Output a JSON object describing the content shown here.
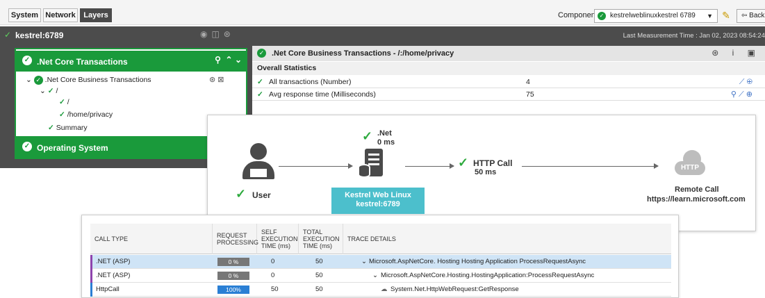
{
  "tabs": [
    "System",
    "Network",
    "Layers"
  ],
  "component": {
    "label": "Component",
    "selected": "kestrelweblinuxkestrel 6789"
  },
  "back_label": "Back",
  "host": {
    "name": "kestrel:6789",
    "last_measurement": "Last Measurement Time : Jan 02, 2023 08:54:24"
  },
  "tree": {
    "header": ".Net Core Transactions",
    "items": [
      ".Net Core Business Transactions",
      "/",
      "/",
      "/home/privacy",
      "Summary"
    ],
    "footer": "Operating System"
  },
  "details": {
    "title": ".Net Core Business Transactions - /:/home/privacy",
    "section": "Overall Statistics",
    "rows": [
      {
        "label": "All transactions (Number)",
        "value": "4"
      },
      {
        "label": "Avg response time (Milliseconds)",
        "value": "75"
      }
    ]
  },
  "topology": {
    "dotnet_label": ".Net",
    "dotnet_time": "0 ms",
    "user_label": "User",
    "http_label": "HTTP Call",
    "http_time": "50 ms",
    "server_name": "Kestrel Web Linux",
    "server_host": "kestrel:6789",
    "cloud_badge": "HTTP",
    "remote_label": "Remote Call",
    "remote_url": "https://learn.microsoft.com"
  },
  "calls": {
    "headers": [
      "CALL TYPE",
      "REQUEST PROCESSING",
      "SELF EXECUTION TIME (ms)",
      "TOTAL EXECUTION TIME (ms)",
      "TRACE DETAILS"
    ],
    "rows": [
      {
        "type": ".NET (ASP)",
        "processing": "0 %",
        "self": "0",
        "total": "50",
        "trace": "Microsoft.AspNetCore. Hosting Hosting Application ProcessRequestAsync",
        "color": "#8e44ad"
      },
      {
        "type": ".NET (ASP)",
        "processing": "0 %",
        "self": "0",
        "total": "50",
        "trace": "Microsoft.AspNetCore.Hosting.HostingApplication:ProcessRequestAsync",
        "color": "#8e44ad"
      },
      {
        "type": "HttpCall",
        "processing": "100%",
        "self": "50",
        "total": "50",
        "trace": "System.Net.HttpWebRequest:GetResponse",
        "color": "#2a7fd4"
      }
    ]
  },
  "colors": {
    "ok_green": "#1a9a3b",
    "server_teal": "#4cbfcc",
    "bar_blue": "#2a7fd4"
  }
}
